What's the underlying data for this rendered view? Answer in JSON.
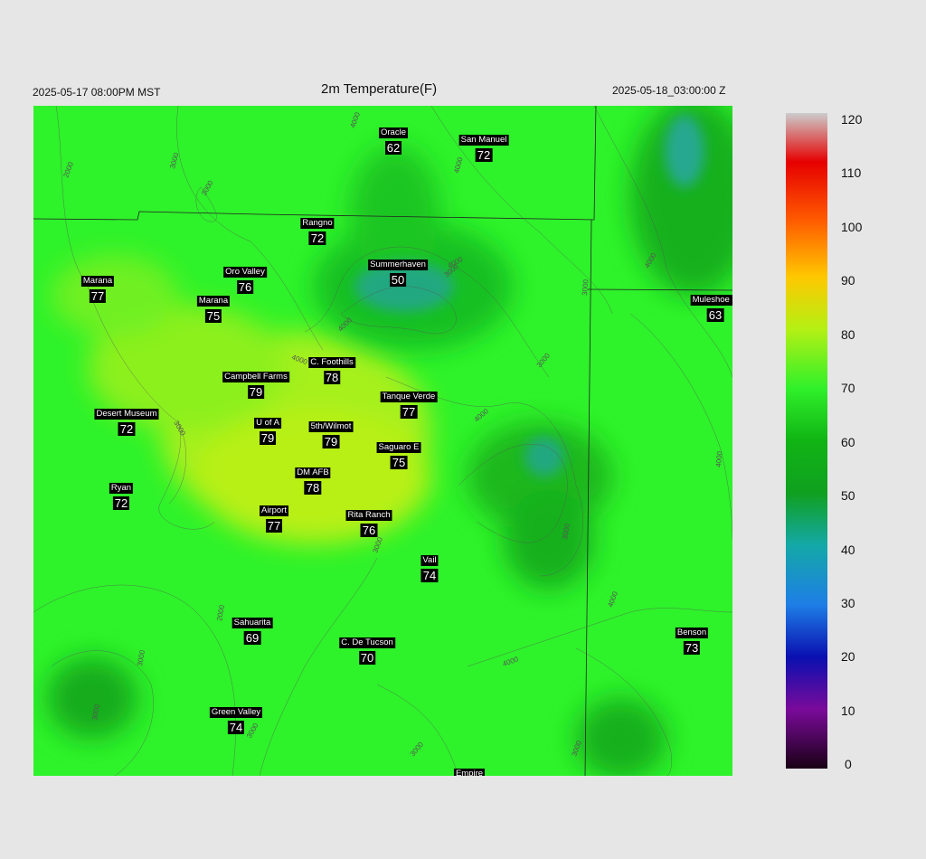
{
  "header": {
    "valid_time": "2025-05-17 08:00PM MST",
    "title": "2m Temperature(F)",
    "run_time": "2025-05-18_03:00:00 Z"
  },
  "stations": [
    {
      "name": "Oracle",
      "value": "62"
    },
    {
      "name": "San Manuel",
      "value": "72"
    },
    {
      "name": "Rangno",
      "value": "72"
    },
    {
      "name": "Summerhaven",
      "value": "50"
    },
    {
      "name": "Oro Valley",
      "value": "76"
    },
    {
      "name": "Marana",
      "value": "77"
    },
    {
      "name": "Marana",
      "value": "75"
    },
    {
      "name": "Muleshoe R",
      "value": "63"
    },
    {
      "name": "C. Foothills",
      "value": "78"
    },
    {
      "name": "Campbell Farms",
      "value": "79"
    },
    {
      "name": "Tanque Verde",
      "value": "77"
    },
    {
      "name": "Desert Museum",
      "value": "72"
    },
    {
      "name": "U of A",
      "value": "79"
    },
    {
      "name": "5th/Wilmot",
      "value": "79"
    },
    {
      "name": "Saguaro E",
      "value": "75"
    },
    {
      "name": "DM AFB",
      "value": "78"
    },
    {
      "name": "Ryan",
      "value": "72"
    },
    {
      "name": "Airport",
      "value": "77"
    },
    {
      "name": "Rita Ranch",
      "value": "76"
    },
    {
      "name": "Vail",
      "value": "74"
    },
    {
      "name": "Sahuarita",
      "value": "69"
    },
    {
      "name": "C. De Tucson",
      "value": "70"
    },
    {
      "name": "Benson",
      "value": "73"
    },
    {
      "name": "Green Valley",
      "value": "74"
    },
    {
      "name": "Empire",
      "value": ""
    }
  ],
  "contour_labels": [
    "2000",
    "3000",
    "3000",
    "4000",
    "4000",
    "4000",
    "4000",
    "4000",
    "3000",
    "3000",
    "3000",
    "3000",
    "4000",
    "3000",
    "4000",
    "4000",
    "2000",
    "3000",
    "3000",
    "3000",
    "4000",
    "3000",
    "4000",
    "3000",
    "3000"
  ],
  "colorbar": {
    "ticks": [
      "120",
      "110",
      "100",
      "90",
      "80",
      "70",
      "60",
      "50",
      "40",
      "30",
      "20",
      "10",
      "0"
    ],
    "colors": {
      "c0": "#1a0015",
      "c10": "#7a0a9a",
      "c20": "#0a10b0",
      "c30": "#1e7ee6",
      "c40": "#14a8a8",
      "c50": "#10a020",
      "c60": "#10b414",
      "c70": "#30f02a",
      "c80": "#b4f014",
      "c90": "#ffc800",
      "c100": "#ff5a00",
      "c110": "#e60000",
      "c120": "#cccccc"
    }
  }
}
